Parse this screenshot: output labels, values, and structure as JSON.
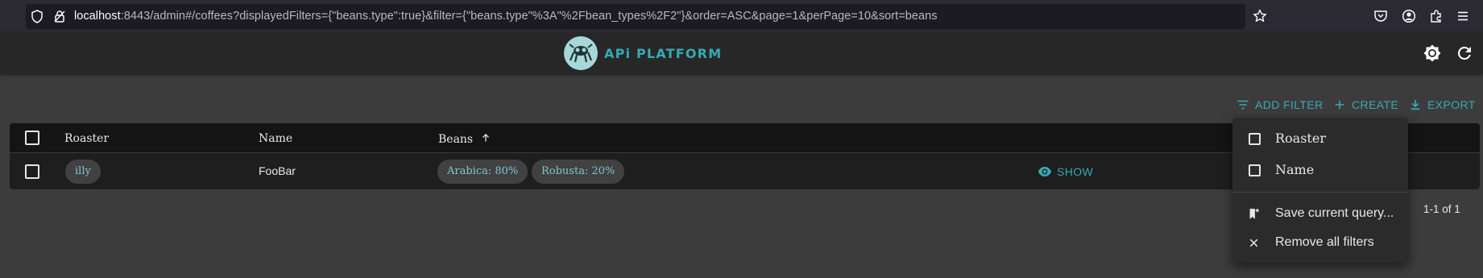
{
  "browser": {
    "url_host": "localhost",
    "url_rest": ":8443/admin#/coffees?displayedFilters={\"beans.type\":true}&filter={\"beans.type\"%3A\"%2Fbean_types%2F2\"}&order=ASC&page=1&perPage=10&sort=beans"
  },
  "app": {
    "logo_text": "APi PLATFORM"
  },
  "toolbar": {
    "add_filter": "ADD FILTER",
    "create": "CREATE",
    "export": "EXPORT"
  },
  "table": {
    "columns": [
      "Roaster",
      "Name",
      "Beans"
    ],
    "sort_column": "Beans",
    "sort_order": "ASC",
    "rows": [
      {
        "roaster": "illy",
        "name": "FooBar",
        "beans": [
          "Arabica: 80%",
          "Robusta: 20%"
        ],
        "action": "SHOW"
      }
    ]
  },
  "pagination": {
    "label": "1-1 of 1"
  },
  "filter_menu": {
    "items": [
      "Roaster",
      "Name"
    ],
    "save_query": "Save current query...",
    "remove_filters": "Remove all filters"
  },
  "colors": {
    "accent": "#38a9b4",
    "background": "#3c3c3c",
    "appbar": "#272727"
  }
}
